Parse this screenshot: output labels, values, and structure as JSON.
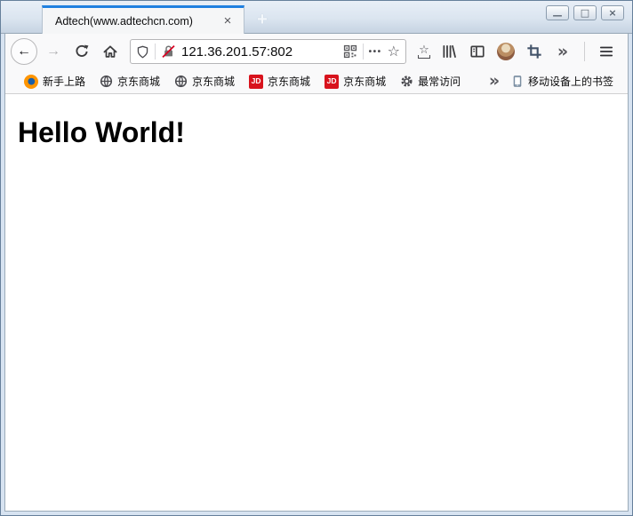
{
  "window_controls": {
    "minimize_glyph": "—",
    "maximize_glyph": "□",
    "close_glyph": "×"
  },
  "tab_bar": {
    "active_tab": {
      "title": "Adtech(www.adtechcn.com)",
      "close_glyph": "×"
    },
    "new_tab_glyph": "+"
  },
  "toolbar": {
    "back_glyph": "←",
    "forward_glyph": "→",
    "url": "121.36.201.57:802",
    "page_actions_glyph": "•••",
    "bookmark_star_glyph": "☆",
    "bookmarks_menu_star_glyph": "☆",
    "overflow_glyph": "»"
  },
  "bookmarks_bar": {
    "items": [
      {
        "icon": "firefox-icon",
        "label": "新手上路"
      },
      {
        "icon": "globe-icon",
        "label": "京东商城"
      },
      {
        "icon": "globe-icon",
        "label": "京东商城"
      },
      {
        "icon": "jd-icon",
        "label": "京东商城",
        "badge": "JD"
      },
      {
        "icon": "jd-icon",
        "label": "京东商城",
        "badge": "JD"
      },
      {
        "icon": "gear-icon",
        "label": "最常访问"
      }
    ],
    "overflow_glyph": "»",
    "mobile_bookmarks": {
      "label": "移动设备上的书签"
    }
  },
  "content": {
    "heading": "Hello World!"
  },
  "icons": {
    "back-icon": "left-arrow",
    "forward-icon": "right-arrow",
    "reload-icon": "clockwise-arc-arrow",
    "home-icon": "house-outline",
    "shield-icon": "shield-outline",
    "insecure-lock-icon": "gray-lock-with-red-slash",
    "qr-code-icon": "qr-squares",
    "page-actions-icon": "three-dots",
    "bookmark-star-icon": "star-outline",
    "bookmarks-menu-icon": "star-on-tray",
    "library-icon": "book-spines",
    "sidebar-icon": "split-rectangle",
    "profile-avatar-icon": "circular-photo",
    "crop-icon": "crop-corners",
    "toolbar-overflow-icon": "double-chevron",
    "menu-icon": "hamburger-lines",
    "firefox-icon": "firefox-logo",
    "globe-icon": "globe-meridians",
    "jd-icon": "red-JD-badge",
    "gear-icon": "gear",
    "phone-icon": "smartphone",
    "minimize-icon": "dash",
    "maximize-icon": "square",
    "close-icon": "cross"
  },
  "colors": {
    "tab_accent_blue": "#1f80e0",
    "frame_blue": "#d7e3f1",
    "jd_red": "#d8131d",
    "lock_slash_red": "#d70022",
    "toolbar_bg": "#f9f9fa"
  }
}
